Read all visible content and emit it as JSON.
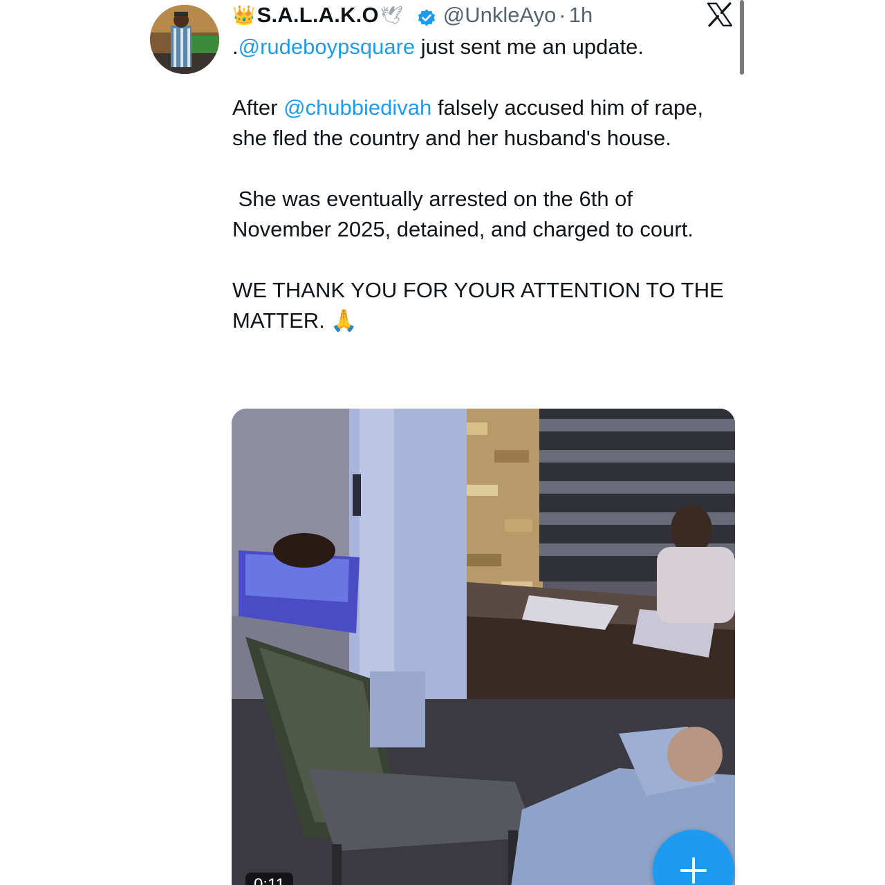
{
  "header": {
    "crown_emoji": "👑",
    "display_name": "S.A.L.A.K.O",
    "dove_emoji": "🕊",
    "handle": "@UnkleAyo",
    "separator": "·",
    "timestamp": "1h"
  },
  "icons": {
    "verified": "verified-badge-icon",
    "brand": "x-logo-icon",
    "fab": "plus-icon"
  },
  "colors": {
    "link": "#1d9bf0",
    "muted": "#536471",
    "text": "#0f1419",
    "fab": "#1d9bf0"
  },
  "tweet": {
    "line1_prefix": ".",
    "line1_mention": "@rudeboypsquare",
    "line1_rest": " just sent me an update.",
    "para2_prefix": "After ",
    "para2_mention": "@chubbiedivah",
    "para2_rest": " falsely accused him of rape, she fled the country and her husband's house.",
    "para3": " She was eventually arrested on the 6th of November 2025, detained, and charged to court.",
    "para4": "WE THANK YOU FOR YOUR ATTENTION TO THE MATTER. 🙏"
  },
  "media": {
    "duration": "0:11"
  }
}
